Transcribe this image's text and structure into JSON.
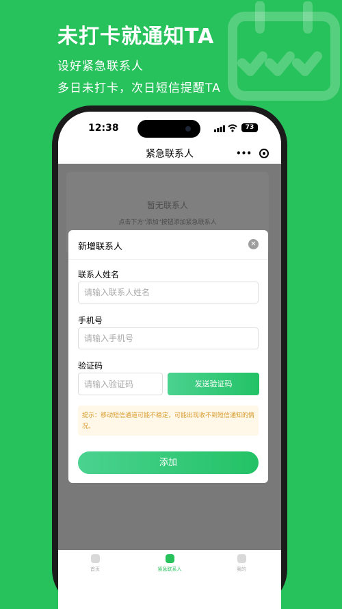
{
  "promo": {
    "title": "未打卡就通知TA",
    "line1": "设好紧急联系人",
    "line2": "多日未打卡，次日短信提醒TA",
    "decor_icon": "calendar-check-icon"
  },
  "status_bar": {
    "time": "12:38",
    "battery": "73"
  },
  "navbar": {
    "title": "紧急联系人",
    "more_icon": "•••",
    "target_icon": "target-icon"
  },
  "empty_state": {
    "title": "暂无联系人",
    "hint": "点击下方\"添加\"按钮添加紧急联系人"
  },
  "modal": {
    "title": "新增联系人",
    "close_icon": "✕",
    "name_label": "联系人姓名",
    "name_placeholder": "请输入联系人姓名",
    "name_value": "",
    "phone_label": "手机号",
    "phone_placeholder": "请输入手机号",
    "phone_value": "",
    "code_label": "验证码",
    "code_placeholder": "请输入验证码",
    "code_value": "",
    "send_code_button": "发送验证码",
    "tip": "提示：移动短信通道可能不稳定，可能出现收不到短信通知的情况。",
    "add_button": "添加"
  },
  "tabbar": {
    "items": [
      {
        "label": "首页",
        "icon": "home-icon",
        "active": false
      },
      {
        "label": "紧急联系人",
        "icon": "contacts-icon",
        "active": true
      },
      {
        "label": "我的",
        "icon": "profile-icon",
        "active": false
      }
    ]
  },
  "colors": {
    "brand": "#27c25c",
    "accent_gradient_start": "#4ad28f",
    "accent_gradient_end": "#23c266",
    "tip_text": "#d89a2a",
    "tip_bg": "#fff8e8"
  }
}
